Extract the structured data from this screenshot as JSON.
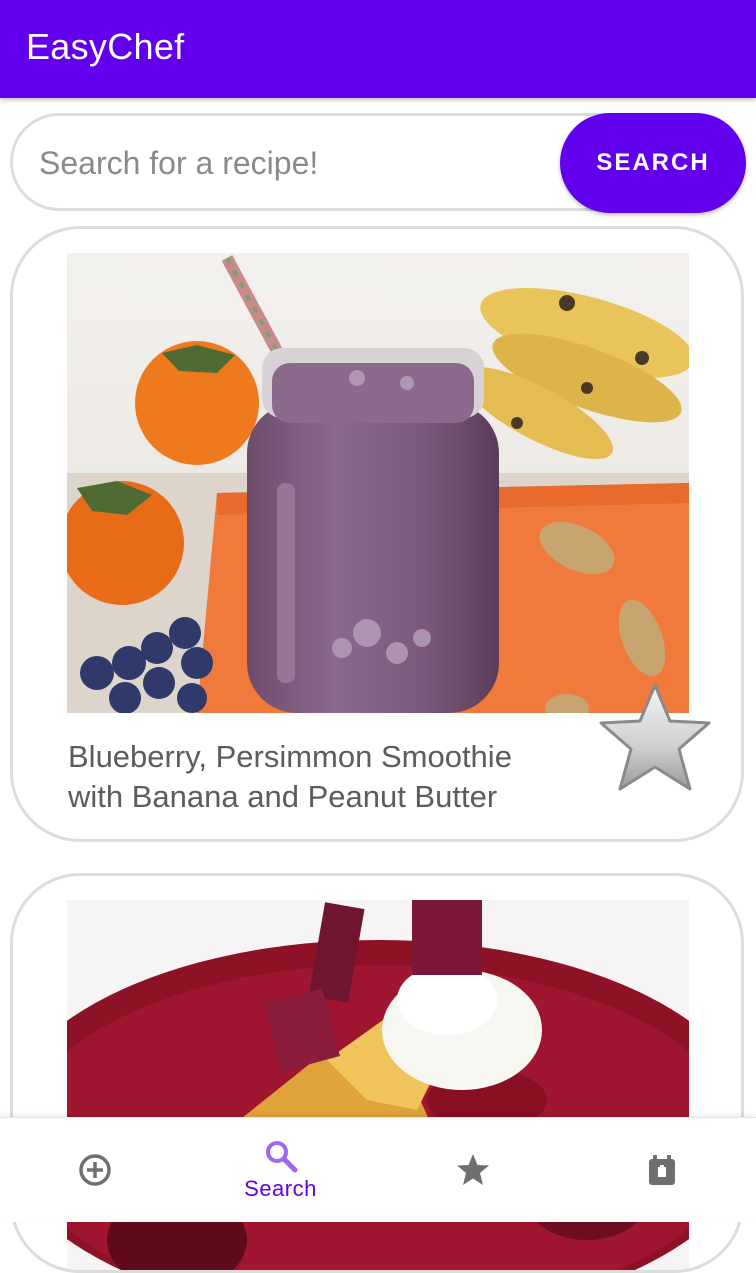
{
  "app": {
    "title": "EasyChef"
  },
  "search": {
    "placeholder": "Search for a recipe!",
    "value": "",
    "button_label": "SEARCH"
  },
  "recipes": [
    {
      "title": "Blueberry, Persimmon Smoothie with Banana and Peanut Butter",
      "favorite_icon": "star-outline-icon",
      "favorited": false
    },
    {
      "title": "",
      "favorite_icon": "star-outline-icon",
      "favorited": false
    }
  ],
  "bottom_nav": {
    "items": [
      {
        "icon": "add-circle-icon",
        "label": "",
        "active": false
      },
      {
        "icon": "search-icon",
        "label": "Search",
        "active": true
      },
      {
        "icon": "star-icon",
        "label": "",
        "active": false
      },
      {
        "icon": "calendar-icon",
        "label": "",
        "active": false
      }
    ]
  },
  "colors": {
    "primary": "#6200ee",
    "nav_inactive": "#6f6f6f",
    "active_icon": "#a066f0",
    "card_border": "#dcdcdc"
  }
}
